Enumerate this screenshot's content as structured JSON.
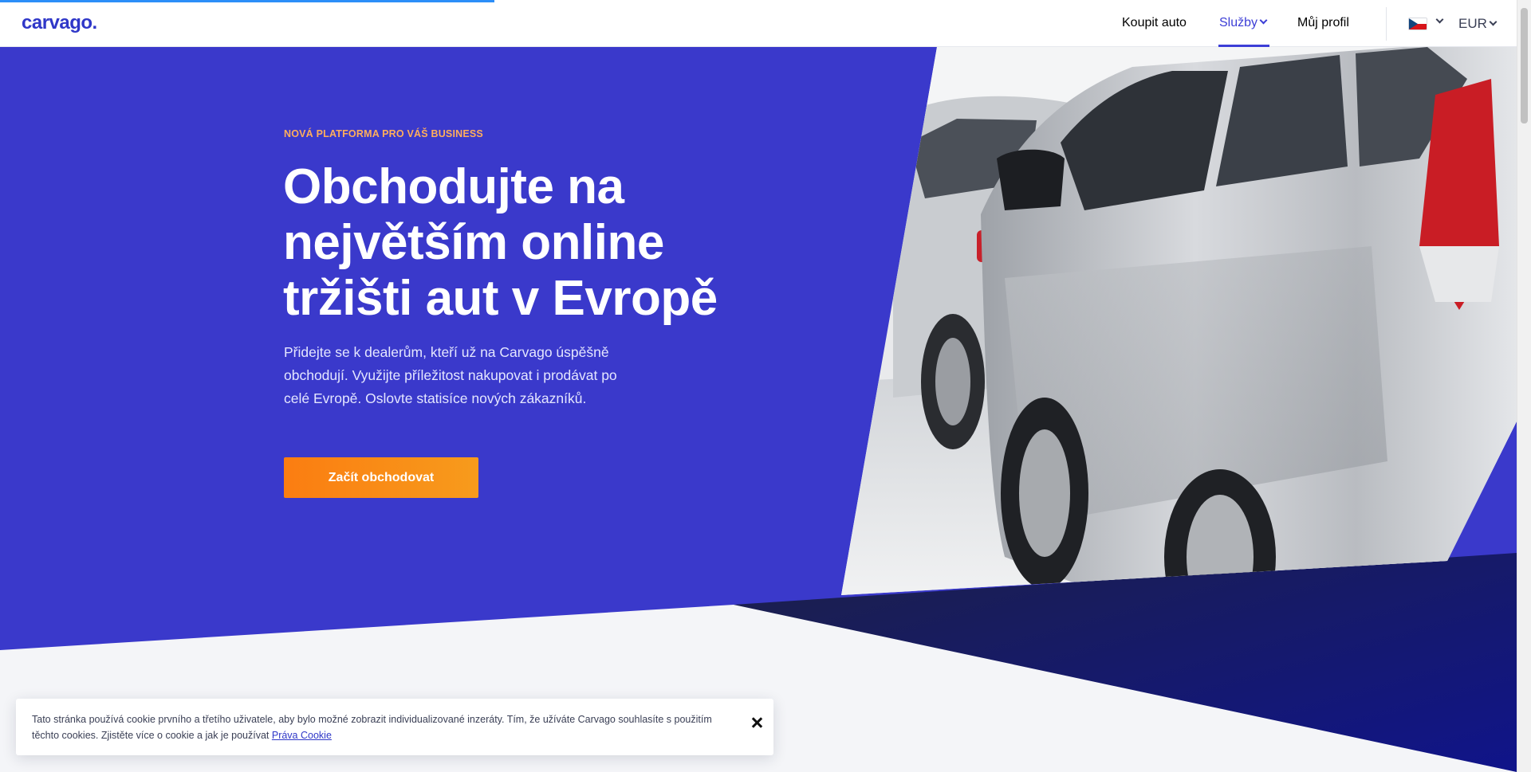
{
  "header": {
    "logo": "carvago.",
    "nav": {
      "buy": "Koupit auto",
      "services": "Služby",
      "profile": "Můj profil"
    },
    "currency": "EUR"
  },
  "hero": {
    "kicker": "NOVÁ PLATFORMA PRO VÁŠ BUSINESS",
    "headline_line1": "Obchodujte na",
    "headline_line2": "největším online",
    "headline_line3": "tržišti aut v Evropě",
    "subtext": "Přidejte se k dealerům, kteří už na Carvago úspěšně obchodují. Využijte příležitost nakupovat i prodávat po celé Evropě. Oslovte statisíce nových zákazníků.",
    "cta": "Začít obchodovat"
  },
  "cookie": {
    "text": "Tato stránka používá cookie prvního a třetího uživatele, aby bylo možné zobrazit individualizované inzeráty. Tím, že užíváte Carvago souhlasíte s použitím těchto cookies. Zjistěte více o cookie a jak je používat ",
    "link": "Práva Cookie"
  },
  "colors": {
    "brand": "#3c3ed6",
    "accent": "#fb7d11",
    "kicker": "#ffae5c"
  },
  "icons": [
    "chevron-down-icon",
    "czech-flag-icon",
    "close-icon"
  ]
}
